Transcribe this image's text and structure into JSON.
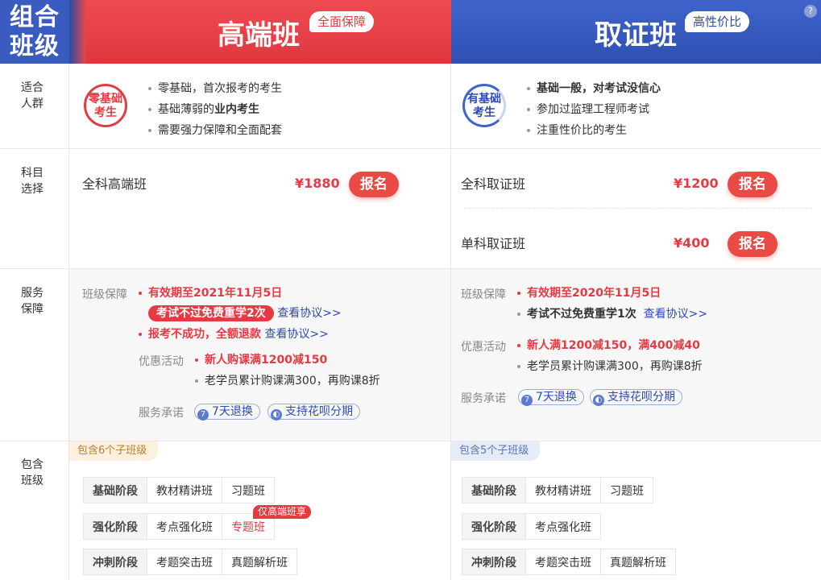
{
  "header": {
    "combo_line1": "组合",
    "combo_line2": "班级",
    "left_title": "高端班",
    "left_badge": "全面保障",
    "right_title": "取证班",
    "right_badge": "高性价比",
    "help": "?"
  },
  "rows": {
    "audience": "适合人群",
    "subject": "科目选择",
    "service": "服务保障",
    "include": "包含班级"
  },
  "left": {
    "circle_line1": "零基础",
    "circle_line2": "考生",
    "audience": [
      "零基础，首次报考的考生",
      "基础薄弱的",
      "业内考生",
      "需要强力保障和全面配套"
    ],
    "course_name": "全科高端班",
    "price": "¥1880",
    "button": "报名",
    "svc_label_guarantee": "班级保障",
    "guarantee_1": "有效期至2021年11月5日",
    "guarantee_2": "考试不过免费重学2次",
    "view_agreement": "查看协议>>",
    "guarantee_3": "报考不成功，全额退款",
    "svc_label_promo": "优惠活动",
    "promo_1": "新人购课满1200减150",
    "promo_2": "老学员累计购课满300，再购课8折",
    "svc_label_promise": "服务承诺",
    "chip_refund": "7天退换",
    "chip_refund_icon": "7",
    "chip_installment": "支持花呗分期",
    "include_tag": "包含6个子班级",
    "exclusive_tag": "仅高端班享",
    "stages": [
      {
        "stage": "基础阶段",
        "classes": [
          "教材精讲班",
          "习题班"
        ]
      },
      {
        "stage": "强化阶段",
        "classes": [
          "考点强化班",
          "专题班"
        ]
      },
      {
        "stage": "冲刺阶段",
        "classes": [
          "考题突击班",
          "真题解析班"
        ]
      }
    ]
  },
  "right": {
    "circle_line1": "有基础",
    "circle_line2": "考生",
    "audience": [
      "基础一般，对考试没信心",
      "参加过监理工程师考试",
      "注重性价比的考生"
    ],
    "course_1_name": "全科取证班",
    "course_1_price": "¥1200",
    "course_2_name": "单科取证班",
    "course_2_price": "¥400",
    "button": "报名",
    "svc_label_guarantee": "班级保障",
    "guarantee_1": "有效期至2020年11月5日",
    "guarantee_2": "考试不过免费重学1次",
    "view_agreement": "查看协议>>",
    "svc_label_promo": "优惠活动",
    "promo_1": "新人满1200减150，满400减40",
    "promo_2": "老学员累计购课满300，再购课8折",
    "svc_label_promise": "服务承诺",
    "chip_refund": "7天退换",
    "chip_refund_icon": "7",
    "chip_installment": "支持花呗分期",
    "include_tag": "包含5个子班级",
    "stages": [
      {
        "stage": "基础阶段",
        "classes": [
          "教材精讲班",
          "习题班"
        ]
      },
      {
        "stage": "强化阶段",
        "classes": [
          "考点强化班"
        ]
      },
      {
        "stage": "冲刺阶段",
        "classes": [
          "考题突击班",
          "真题解析班"
        ]
      }
    ]
  },
  "colors": {
    "red": "#e63a42",
    "blue": "#2c4bb5",
    "header_red": "#ef4b52",
    "header_blue": "#3f64cc"
  }
}
